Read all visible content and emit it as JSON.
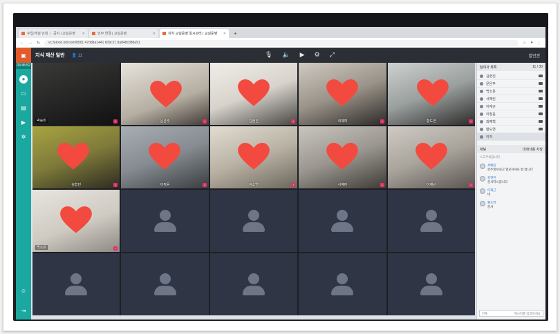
{
  "browser": {
    "tabs": [
      {
        "label": "수업/개설 안내 ⋮ 공지 | 교실운영",
        "active": false
      },
      {
        "label": "외부 연결 | 교실운영",
        "active": false
      },
      {
        "label": "지식 교실운영 일시관리 | 교실운영",
        "active": true
      }
    ],
    "url": "vc.fatoon.kr/room/8561 47dd8a1441 609c21 8a848c988a91"
  },
  "app": {
    "room_title": "지식 재산 일반",
    "participant_count": "11",
    "exit_label": "발언권",
    "timer": "03:45:52"
  },
  "tiles": [
    {
      "name": "박승민",
      "heart": false
    },
    {
      "name": "문은주",
      "heart": true
    },
    {
      "name": "김현진",
      "heart": true
    },
    {
      "name": "최예혁",
      "heart": true
    },
    {
      "name": "황도연",
      "heart": true
    },
    {
      "name": "김형민",
      "heart": true
    },
    {
      "name": "이정윤",
      "heart": true
    },
    {
      "name": "김소연",
      "heart": true
    },
    {
      "name": "서예린",
      "heart": true
    },
    {
      "name": "이재근",
      "heart": true
    },
    {
      "name": "백소은",
      "heart": true
    }
  ],
  "empty_tile_count": 9,
  "participants_panel": {
    "title": "참여자 목록",
    "count": "11 / 30",
    "names": [
      "김현진",
      "문은주",
      "백소은",
      "서예린",
      "이재근",
      "이정윤",
      "최예혁",
      "황도연",
      "이자"
    ]
  },
  "chat_panel": {
    "title": "채팅",
    "option": "대화내용 저장",
    "system_msg": "스고주의입니다",
    "messages": [
      {
        "who": "서예린",
        "text": "한주할보내고 열요하세요 잘 합니다"
      },
      {
        "who": "김현진",
        "text": "감사하시겠니다"
      },
      {
        "who": "이재근",
        "text": "네"
      },
      {
        "who": "황도연",
        "text": "감사"
      }
    ],
    "input_placeholder": "전체",
    "send_label": "메시지를 입력하세요"
  }
}
